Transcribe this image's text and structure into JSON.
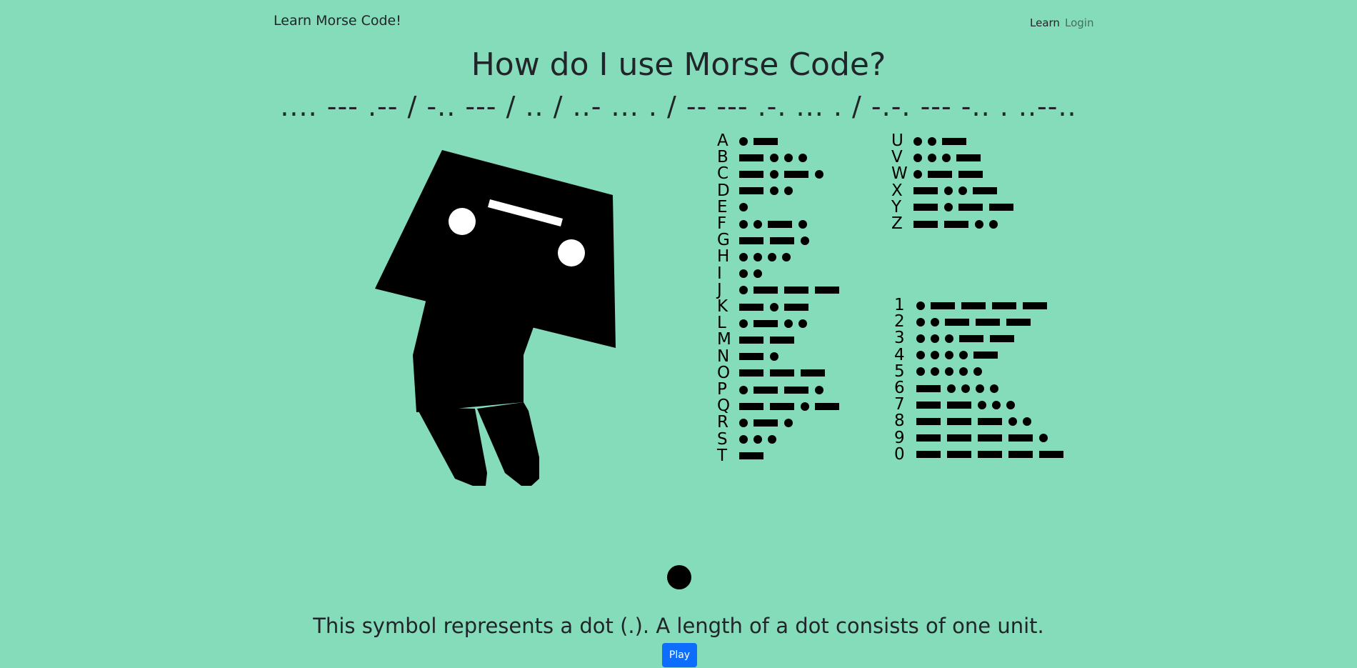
{
  "navbar": {
    "brand": "Learn Morse Code!",
    "links": [
      {
        "label": "Learn",
        "active": true
      },
      {
        "label": "Login",
        "active": false
      }
    ]
  },
  "page": {
    "title": "How do I use Morse Code?",
    "title_in_morse": ".... --- .-- / -.. --- / .. / ..- ... . / -- --- .-. ... . / -.-. --- -.. . ..--.."
  },
  "morse_chart": {
    "letters_col1": [
      {
        "char": "A",
        "code": ".-"
      },
      {
        "char": "B",
        "code": "-..."
      },
      {
        "char": "C",
        "code": "-.-."
      },
      {
        "char": "D",
        "code": "-.."
      },
      {
        "char": "E",
        "code": "."
      },
      {
        "char": "F",
        "code": "..-."
      },
      {
        "char": "G",
        "code": "--."
      },
      {
        "char": "H",
        "code": "...."
      },
      {
        "char": "I",
        "code": ".."
      },
      {
        "char": "J",
        "code": ".---"
      },
      {
        "char": "K",
        "code": "-.-"
      },
      {
        "char": "L",
        "code": ".-.."
      },
      {
        "char": "M",
        "code": "--"
      },
      {
        "char": "N",
        "code": "-."
      },
      {
        "char": "O",
        "code": "---"
      },
      {
        "char": "P",
        "code": ".--."
      },
      {
        "char": "Q",
        "code": "--.-"
      },
      {
        "char": "R",
        "code": ".-."
      },
      {
        "char": "S",
        "code": "..."
      },
      {
        "char": "T",
        "code": "-"
      }
    ],
    "letters_col2": [
      {
        "char": "U",
        "code": "..-"
      },
      {
        "char": "V",
        "code": "...-"
      },
      {
        "char": "W",
        "code": ".--"
      },
      {
        "char": "X",
        "code": "-..-"
      },
      {
        "char": "Y",
        "code": "-.--"
      },
      {
        "char": "Z",
        "code": "--.."
      }
    ],
    "digits": [
      {
        "char": "1",
        "code": ".----"
      },
      {
        "char": "2",
        "code": "..---"
      },
      {
        "char": "3",
        "code": "...--"
      },
      {
        "char": "4",
        "code": "....-"
      },
      {
        "char": "5",
        "code": "....."
      },
      {
        "char": "6",
        "code": "-...."
      },
      {
        "char": "7",
        "code": "--..."
      },
      {
        "char": "8",
        "code": "---.."
      },
      {
        "char": "9",
        "code": "----."
      },
      {
        "char": "0",
        "code": "-----"
      }
    ]
  },
  "lesson": {
    "current_symbol": "dot",
    "description": "This symbol represents a dot (.). A length of a dot consists of one unit.",
    "play_label": "Play"
  },
  "colors": {
    "background": "#85dcba",
    "play_button": "#0d6efd",
    "ink": "#000000"
  }
}
